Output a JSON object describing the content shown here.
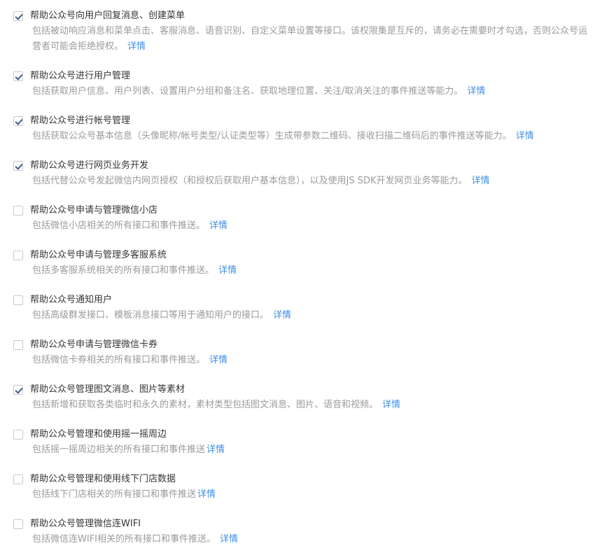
{
  "permissions": [
    {
      "title": "帮助公众号向用户回复消息、创建菜单",
      "desc": "包括被动响应消息和菜单点击、客服消息、语音识别、自定义菜单设置等接口。该权限集是互斥的，请务必在需要时才勾选，否则公众号运营者可能会拒绝授权。",
      "link": "详情",
      "checked": true
    },
    {
      "title": "帮助公众号进行用户管理",
      "desc": "包括获取用户信息、用户列表、设置用户分组和备注名、获取地理位置、关注/取消关注的事件推送等能力。",
      "link": "详情",
      "checked": true
    },
    {
      "title": "帮助公众号进行帐号管理",
      "desc": "包括获取公众号基本信息（头像昵称/帐号类型/认证类型等）生成带参数二维码、接收扫描二维码后的事件推送等能力。",
      "link": "详情",
      "checked": true
    },
    {
      "title": "帮助公众号进行网页业务开发",
      "desc": "包括代替公众号发起微信内网页授权（和授权后获取用户基本信息），以及使用JS SDK开发网页业务等能力。",
      "link": "详情",
      "checked": true
    },
    {
      "title": "帮助公众号申请与管理微信小店",
      "desc": "包括微信小店相关的所有接口和事件推送。",
      "link": "详情",
      "checked": false
    },
    {
      "title": "帮助公众号申请与管理多客服系统",
      "desc": "包括多客服系统相关的所有接口和事件推送。",
      "link": "详情",
      "checked": false
    },
    {
      "title": "帮助公众号通知用户",
      "desc": "包括高级群发接口、模板消息接口等用于通知用户的接口。",
      "link": "详情",
      "checked": false
    },
    {
      "title": "帮助公众号申请与管理微信卡券",
      "desc": "包括微信卡券相关的所有接口和事件推送。",
      "link": "详情",
      "checked": false
    },
    {
      "title": "帮助公众号管理图文消息、图片等素材",
      "desc": "包括新增和获取各类临时和永久的素材，素材类型包括图文消息、图片、语音和视频。",
      "link": "详情",
      "checked": true
    },
    {
      "title": "帮助公众号管理和使用摇一摇周边",
      "desc": "包括摇一摇周边相关的所有接口和事件推送",
      "link": "详情",
      "checked": false
    },
    {
      "title": "帮助公众号管理和使用线下门店数据",
      "desc": "包括线下门店相关的所有接口和事件推送",
      "link": "详情",
      "checked": false
    },
    {
      "title": "帮助公众号管理微信连WIFI",
      "desc": "包括微信连WIFI相关的所有接口和事件推送。",
      "link": "详情",
      "checked": false
    }
  ]
}
